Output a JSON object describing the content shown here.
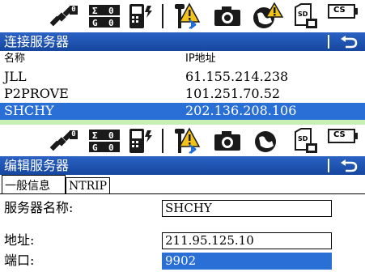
{
  "icons": {
    "satellite": "satellite-icon",
    "sigma": "sigma-icon",
    "battery": "controller-battery-icon",
    "receiver": "receiver-bluetooth-icon",
    "camera": "camera-icon",
    "globe": "globe-warning-icon",
    "sd": "sd-card-icon",
    "cs": "cs-battery-icon"
  },
  "statusbar": {
    "satellite_count": "0",
    "sigma_top": "0",
    "sigma_bottom": "0",
    "sigma_letter_top": "Σ",
    "sigma_letter_bottom": "G",
    "cs_label": "CS",
    "sd_label": "SD"
  },
  "screen1": {
    "title": "连接服务器",
    "columns": {
      "name": "名称",
      "ip": "IP地址"
    },
    "servers": [
      {
        "name": "JLL",
        "ip": "61.155.214.238"
      },
      {
        "name": "P2PROVE",
        "ip": "101.251.70.52"
      },
      {
        "name": "SHCHY",
        "ip": "202.136.208.106",
        "selected": true
      }
    ]
  },
  "screen2": {
    "title": "编辑服务器",
    "tabs": [
      {
        "label": "一般信息",
        "active": true
      },
      {
        "label": "NTRIP",
        "active": false
      }
    ],
    "fields": {
      "name_label": "服务器名称:",
      "name_value": "SHCHY",
      "address_label": "地址:",
      "address_value": "211.95.125.10",
      "port_label": "端口:",
      "port_value": "9902"
    }
  },
  "colors": {
    "titlebar": "#1f56b3",
    "selection": "#2a6fd6",
    "strip": "#c7efb4"
  }
}
